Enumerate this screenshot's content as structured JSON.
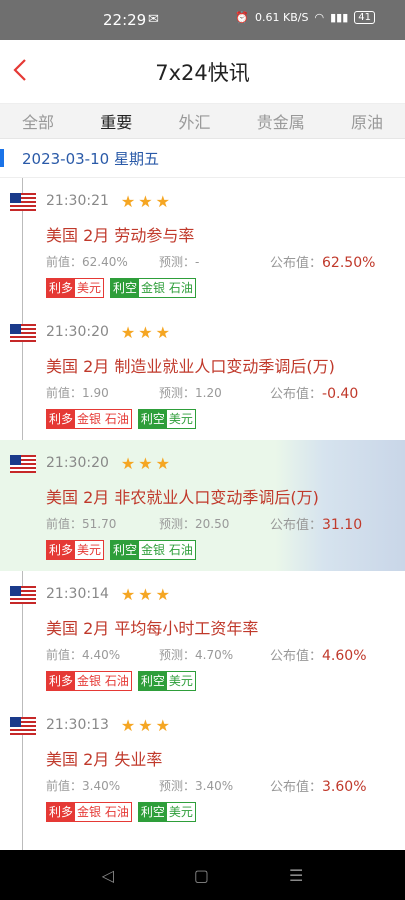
{
  "status": {
    "time": "22:29",
    "msg_icon": "message-icon",
    "speed": "0.61 KB/S",
    "battery": "41"
  },
  "header": {
    "title": "7x24快讯"
  },
  "tabs": [
    "全部",
    "重要",
    "外汇",
    "贵金属",
    "原油"
  ],
  "active_tab": 1,
  "date": "2023-03-10 星期五",
  "colors": {
    "bull": "#e53935",
    "bear": "#2e9e3a",
    "headline": "#c0392b",
    "star": "#f5a623"
  },
  "items": [
    {
      "time": "21:30:21",
      "stars": "★★★",
      "headline": "美国 2月 劳动参与率",
      "prev_label": "前值：62.40%",
      "forecast_label": "预测：-",
      "actual_label": "公布值：",
      "actual": "62.50%",
      "tag1_label": "利多",
      "tag1_value": "美元",
      "tag2_label": "利空",
      "tag2_value": "金银 石油",
      "tag1_bull": true
    },
    {
      "time": "21:30:20",
      "stars": "★★★",
      "headline": "美国 2月 制造业就业人口变动季调后(万)",
      "prev_label": "前值：1.90",
      "forecast_label": "预测：1.20",
      "actual_label": "公布值：",
      "actual": "-0.40",
      "tag1_label": "利多",
      "tag1_value": "金银 石油",
      "tag2_label": "利空",
      "tag2_value": "美元",
      "tag1_bull": true
    },
    {
      "time": "21:30:20",
      "stars": "★★★",
      "headline": "美国 2月 非农就业人口变动季调后(万)",
      "prev_label": "前值：51.70",
      "forecast_label": "预测：20.50",
      "actual_label": "公布值：",
      "actual": "31.10",
      "tag1_label": "利多",
      "tag1_value": "美元",
      "tag2_label": "利空",
      "tag2_value": "金银 石油",
      "tag1_bull": true
    },
    {
      "time": "21:30:14",
      "stars": "★★★",
      "headline": "美国 2月 平均每小时工资年率",
      "prev_label": "前值：4.40%",
      "forecast_label": "预测：4.70%",
      "actual_label": "公布值：",
      "actual": "4.60%",
      "tag1_label": "利多",
      "tag1_value": "金银 石油",
      "tag2_label": "利空",
      "tag2_value": "美元",
      "tag1_bull": true
    },
    {
      "time": "21:30:13",
      "stars": "★★★",
      "headline": "美国 2月 失业率",
      "prev_label": "前值：3.40%",
      "forecast_label": "预测：3.40%",
      "actual_label": "公布值：",
      "actual": "3.60%",
      "tag1_label": "利多",
      "tag1_value": "金银 石油",
      "tag2_label": "利空",
      "tag2_value": "美元",
      "tag1_bull": true
    }
  ],
  "navbar": {
    "back": "◁",
    "home": "▢",
    "recents": "☰"
  }
}
